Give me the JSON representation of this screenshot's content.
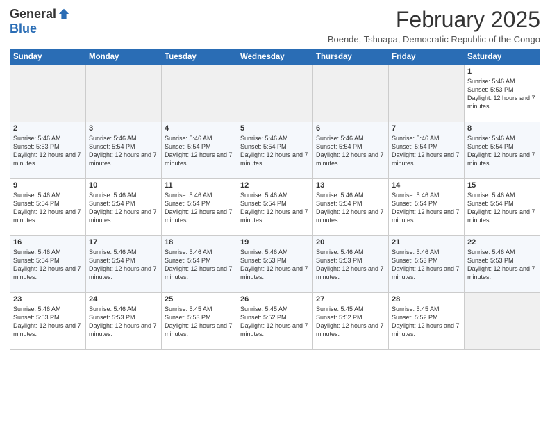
{
  "header": {
    "logo_general": "General",
    "logo_blue": "Blue",
    "month_title": "February 2025",
    "subtitle": "Boende, Tshuapa, Democratic Republic of the Congo"
  },
  "weekdays": [
    "Sunday",
    "Monday",
    "Tuesday",
    "Wednesday",
    "Thursday",
    "Friday",
    "Saturday"
  ],
  "weeks": [
    [
      {
        "day": "",
        "empty": true
      },
      {
        "day": "",
        "empty": true
      },
      {
        "day": "",
        "empty": true
      },
      {
        "day": "",
        "empty": true
      },
      {
        "day": "",
        "empty": true
      },
      {
        "day": "",
        "empty": true
      },
      {
        "day": "1",
        "sunrise": "5:46 AM",
        "sunset": "5:53 PM",
        "daylight": "12 hours and 7 minutes."
      }
    ],
    [
      {
        "day": "2",
        "sunrise": "5:46 AM",
        "sunset": "5:53 PM",
        "daylight": "12 hours and 7 minutes."
      },
      {
        "day": "3",
        "sunrise": "5:46 AM",
        "sunset": "5:54 PM",
        "daylight": "12 hours and 7 minutes."
      },
      {
        "day": "4",
        "sunrise": "5:46 AM",
        "sunset": "5:54 PM",
        "daylight": "12 hours and 7 minutes."
      },
      {
        "day": "5",
        "sunrise": "5:46 AM",
        "sunset": "5:54 PM",
        "daylight": "12 hours and 7 minutes."
      },
      {
        "day": "6",
        "sunrise": "5:46 AM",
        "sunset": "5:54 PM",
        "daylight": "12 hours and 7 minutes."
      },
      {
        "day": "7",
        "sunrise": "5:46 AM",
        "sunset": "5:54 PM",
        "daylight": "12 hours and 7 minutes."
      },
      {
        "day": "8",
        "sunrise": "5:46 AM",
        "sunset": "5:54 PM",
        "daylight": "12 hours and 7 minutes."
      }
    ],
    [
      {
        "day": "9",
        "sunrise": "5:46 AM",
        "sunset": "5:54 PM",
        "daylight": "12 hours and 7 minutes."
      },
      {
        "day": "10",
        "sunrise": "5:46 AM",
        "sunset": "5:54 PM",
        "daylight": "12 hours and 7 minutes."
      },
      {
        "day": "11",
        "sunrise": "5:46 AM",
        "sunset": "5:54 PM",
        "daylight": "12 hours and 7 minutes."
      },
      {
        "day": "12",
        "sunrise": "5:46 AM",
        "sunset": "5:54 PM",
        "daylight": "12 hours and 7 minutes."
      },
      {
        "day": "13",
        "sunrise": "5:46 AM",
        "sunset": "5:54 PM",
        "daylight": "12 hours and 7 minutes."
      },
      {
        "day": "14",
        "sunrise": "5:46 AM",
        "sunset": "5:54 PM",
        "daylight": "12 hours and 7 minutes."
      },
      {
        "day": "15",
        "sunrise": "5:46 AM",
        "sunset": "5:54 PM",
        "daylight": "12 hours and 7 minutes."
      }
    ],
    [
      {
        "day": "16",
        "sunrise": "5:46 AM",
        "sunset": "5:54 PM",
        "daylight": "12 hours and 7 minutes."
      },
      {
        "day": "17",
        "sunrise": "5:46 AM",
        "sunset": "5:54 PM",
        "daylight": "12 hours and 7 minutes."
      },
      {
        "day": "18",
        "sunrise": "5:46 AM",
        "sunset": "5:54 PM",
        "daylight": "12 hours and 7 minutes."
      },
      {
        "day": "19",
        "sunrise": "5:46 AM",
        "sunset": "5:53 PM",
        "daylight": "12 hours and 7 minutes."
      },
      {
        "day": "20",
        "sunrise": "5:46 AM",
        "sunset": "5:53 PM",
        "daylight": "12 hours and 7 minutes."
      },
      {
        "day": "21",
        "sunrise": "5:46 AM",
        "sunset": "5:53 PM",
        "daylight": "12 hours and 7 minutes."
      },
      {
        "day": "22",
        "sunrise": "5:46 AM",
        "sunset": "5:53 PM",
        "daylight": "12 hours and 7 minutes."
      }
    ],
    [
      {
        "day": "23",
        "sunrise": "5:46 AM",
        "sunset": "5:53 PM",
        "daylight": "12 hours and 7 minutes."
      },
      {
        "day": "24",
        "sunrise": "5:46 AM",
        "sunset": "5:53 PM",
        "daylight": "12 hours and 7 minutes."
      },
      {
        "day": "25",
        "sunrise": "5:45 AM",
        "sunset": "5:53 PM",
        "daylight": "12 hours and 7 minutes."
      },
      {
        "day": "26",
        "sunrise": "5:45 AM",
        "sunset": "5:52 PM",
        "daylight": "12 hours and 7 minutes."
      },
      {
        "day": "27",
        "sunrise": "5:45 AM",
        "sunset": "5:52 PM",
        "daylight": "12 hours and 7 minutes."
      },
      {
        "day": "28",
        "sunrise": "5:45 AM",
        "sunset": "5:52 PM",
        "daylight": "12 hours and 7 minutes."
      },
      {
        "day": "",
        "empty": true
      }
    ]
  ],
  "labels": {
    "sunrise_prefix": "Sunrise: ",
    "sunset_prefix": "Sunset: ",
    "daylight_prefix": "Daylight: "
  }
}
